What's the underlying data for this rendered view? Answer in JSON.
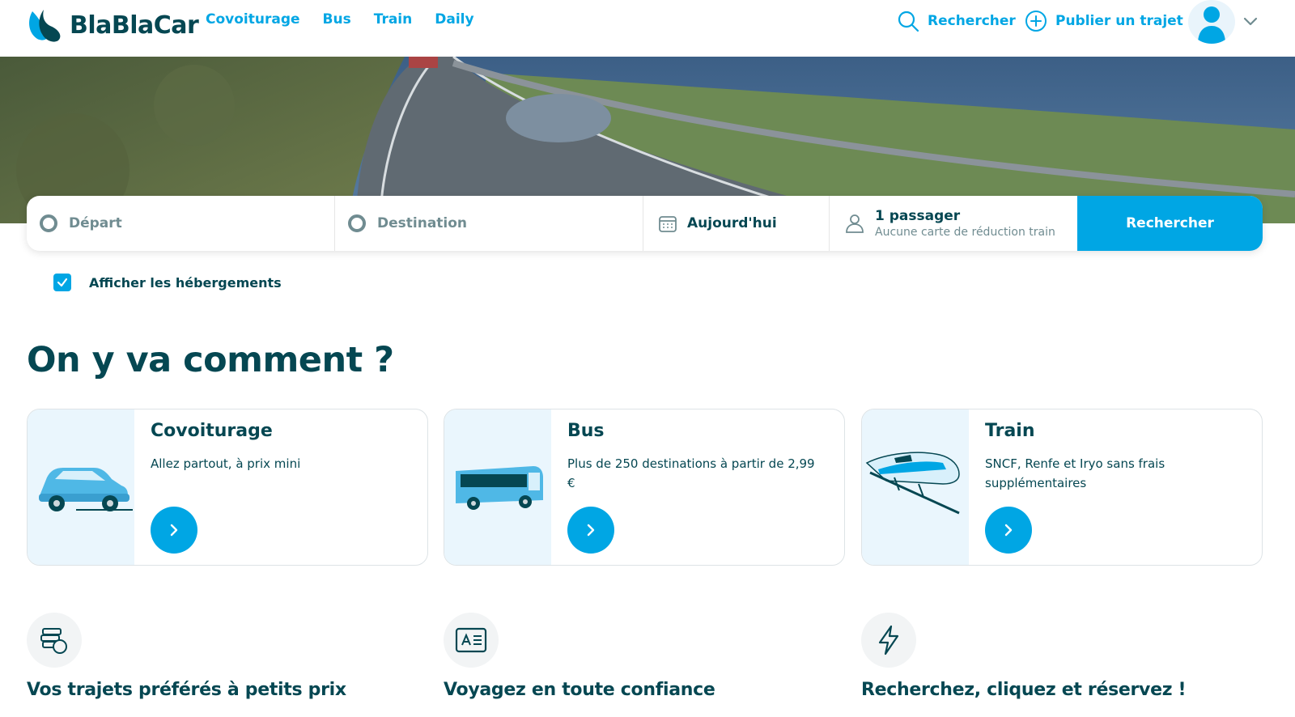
{
  "header": {
    "brand": "BlaBlaCar",
    "nav": [
      "Covoiturage",
      "Bus",
      "Train",
      "Daily"
    ],
    "search_label": "Rechercher",
    "publish_label": "Publier un trajet"
  },
  "search": {
    "departure_placeholder": "Départ",
    "destination_placeholder": "Destination",
    "date_value": "Aujourd'hui",
    "passenger_title": "1 passager",
    "passenger_subtitle": "Aucune carte de réduction train",
    "button_label": "Rechercher"
  },
  "lodging": {
    "label": "Afficher les hébergements",
    "checked": true
  },
  "section_title": "On y va comment ?",
  "cards": [
    {
      "title": "Covoiturage",
      "description": "Allez partout, à prix mini",
      "icon": "car-icon"
    },
    {
      "title": "Bus",
      "description": "Plus de 250 destinations à partir de 2,99 €",
      "icon": "bus-icon"
    },
    {
      "title": "Train",
      "description": "SNCF, Renfe et Iryo sans frais supplémentaires",
      "icon": "train-icon"
    }
  ],
  "features": [
    {
      "title": "Vos trajets préférés à petits prix",
      "icon": "coins-icon"
    },
    {
      "title": "Voyagez en toute confiance",
      "icon": "id-card-icon"
    },
    {
      "title": "Recherchez, cliquez et réservez !",
      "icon": "lightning-icon"
    }
  ],
  "colors": {
    "primary": "#00a6e4",
    "text": "#054752",
    "muted": "#708c91",
    "card_image_bg": "#eaf6fd"
  }
}
